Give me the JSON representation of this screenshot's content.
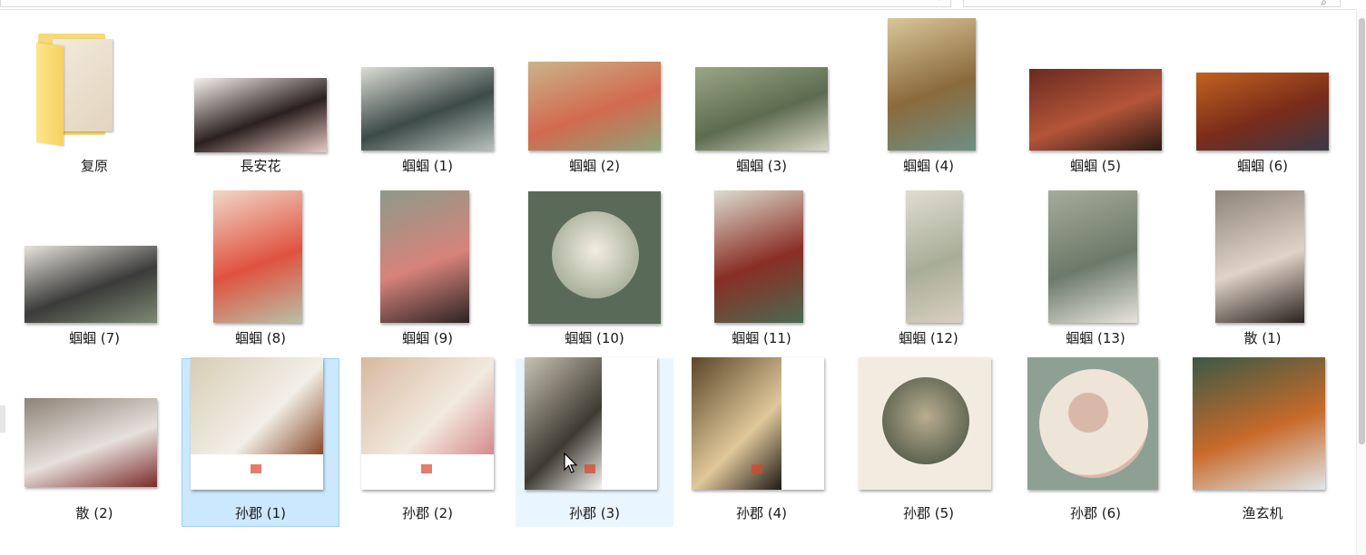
{
  "toolbar": {
    "path_text": "",
    "search_placeholder": "",
    "refresh_icon": "refresh-icon",
    "search_icon": "search-icon"
  },
  "items": [
    {
      "label": "复原",
      "type": "folder"
    },
    {
      "label": "長安花",
      "type": "image",
      "colors": [
        "#f6f1ec",
        "#2b2020",
        "#e8c9c2"
      ]
    },
    {
      "label": "蝈蝈 (1)",
      "type": "image",
      "colors": [
        "#dcdcd6",
        "#3c4a48",
        "#b8c2bd"
      ]
    },
    {
      "label": "蝈蝈 (2)",
      "type": "image",
      "colors": [
        "#c9b48a",
        "#d26a4f",
        "#8ea37a"
      ]
    },
    {
      "label": "蝈蝈 (3)",
      "type": "image",
      "colors": [
        "#9aa686",
        "#5d6b4f",
        "#d8d6c6"
      ]
    },
    {
      "label": "蝈蝈 (4)",
      "type": "image",
      "colors": [
        "#d8c79a",
        "#8b6a3c",
        "#6d8f86"
      ]
    },
    {
      "label": "蝈蝈 (5)",
      "type": "image",
      "colors": [
        "#6a2a1f",
        "#b4553a",
        "#2c1a14"
      ]
    },
    {
      "label": "蝈蝈 (6)",
      "type": "image",
      "colors": [
        "#c1621f",
        "#7a2c1a",
        "#3a3a4a"
      ]
    },
    {
      "label": "蝈蝈 (7)",
      "type": "image",
      "colors": [
        "#e6e3dc",
        "#3b3b3b",
        "#7e8a72"
      ]
    },
    {
      "label": "蝈蝈 (8)",
      "type": "image",
      "colors": [
        "#f0d7c8",
        "#e0523f",
        "#b9c0a6"
      ]
    },
    {
      "label": "蝈蝈 (9)",
      "type": "image",
      "colors": [
        "#8c9a88",
        "#d7837c",
        "#2c2422"
      ]
    },
    {
      "label": "蝈蝈 (10)",
      "type": "image",
      "colors": [
        "#f2ede2",
        "#8e9a80",
        "#5a6a58"
      ]
    },
    {
      "label": "蝈蝈 (11)",
      "type": "image",
      "colors": [
        "#dcdcd0",
        "#8a2e24",
        "#4a6a52"
      ]
    },
    {
      "label": "蝈蝈 (12)",
      "type": "image",
      "colors": [
        "#e0ddd0",
        "#a8ad98",
        "#d8cfc0"
      ]
    },
    {
      "label": "蝈蝈 (13)",
      "type": "image",
      "colors": [
        "#a6ab98",
        "#6c7a6a",
        "#e8e4dc"
      ]
    },
    {
      "label": "散 (1)",
      "type": "image",
      "colors": [
        "#8e8478",
        "#e0d2c6",
        "#2a2320"
      ]
    },
    {
      "label": "散 (2)",
      "type": "image",
      "colors": [
        "#8e8276",
        "#e6e0dc",
        "#7a2a2a"
      ]
    },
    {
      "label": "孙郡 (1)",
      "type": "image",
      "colors": [
        "#d8cdb4",
        "#f2efe8",
        "#8a4a2a"
      ]
    },
    {
      "label": "孙郡 (2)",
      "type": "image",
      "colors": [
        "#d8b8a0",
        "#f2eadf",
        "#d48a8a"
      ]
    },
    {
      "label": "孙郡 (3)",
      "type": "image",
      "colors": [
        "#c8c2b2",
        "#3e3a32",
        "#f6f4f0"
      ]
    },
    {
      "label": "孙郡 (4)",
      "type": "image",
      "colors": [
        "#5a4628",
        "#e0c89a",
        "#1e1a16"
      ]
    },
    {
      "label": "孙郡 (5)",
      "type": "image",
      "colors": [
        "#b8ad90",
        "#3e4a3a",
        "#f2ece0"
      ]
    },
    {
      "label": "孙郡 (6)",
      "type": "image",
      "colors": [
        "#efe4d8",
        "#d8b8a8",
        "#8ea094"
      ]
    },
    {
      "label": "渔玄机",
      "type": "image",
      "colors": [
        "#3a5a46",
        "#c86a2a",
        "#dfe6e8"
      ]
    }
  ],
  "selected_index": 17,
  "hover_index": 19
}
